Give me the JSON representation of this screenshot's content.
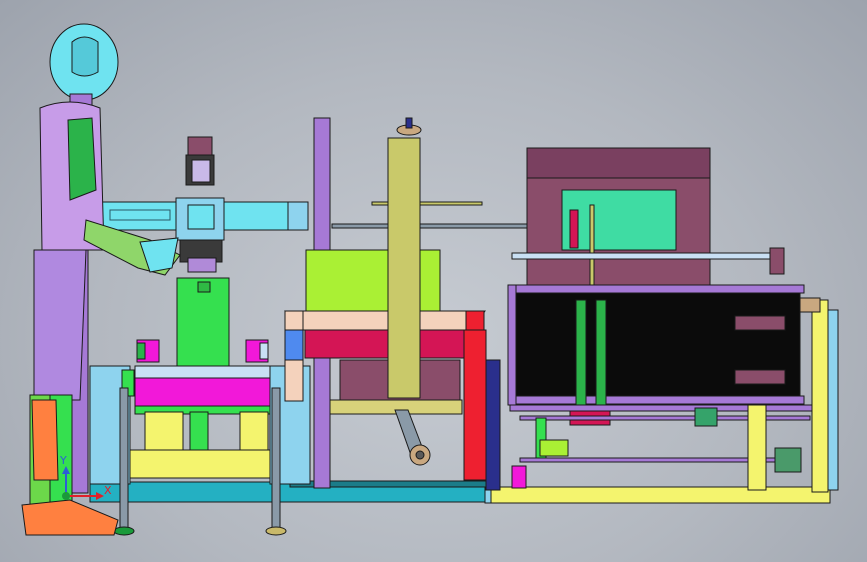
{
  "viewport": {
    "background": "#b8bdc5"
  },
  "triad": {
    "x_label": "X",
    "y_label": "Y",
    "x_color": "#e0202a",
    "y_color": "#2e5ed6",
    "origin_color": "#1a9a3a"
  },
  "palette": {
    "cyan": "#6fe3f0",
    "sky": "#8ed3ee",
    "purple": "#a679d6",
    "magenta": "#f218d9",
    "green": "#35e04f",
    "lime": "#aaf034",
    "yellow": "#f4f46e",
    "olive": "#c9c96a",
    "red": "#ee2030",
    "crimson": "#d41555",
    "mauve": "#8a4d6a",
    "teal": "#24b0c2",
    "navy": "#2a2f8c",
    "orange": "#ff8040",
    "peach": "#f4d2bc",
    "mint": "#3fdca3",
    "black": "#0b0b0b"
  }
}
